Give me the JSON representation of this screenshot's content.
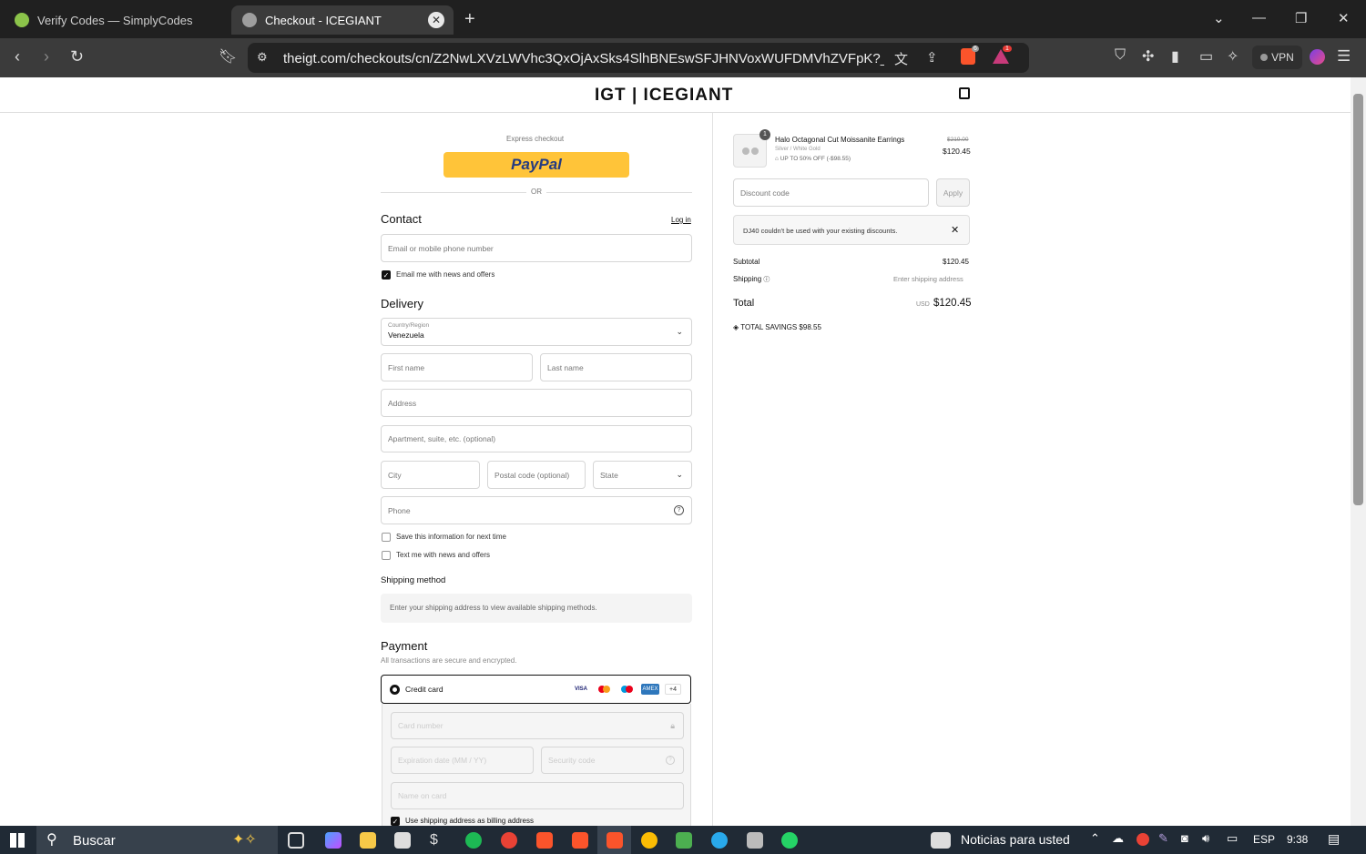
{
  "browser": {
    "tabs": [
      {
        "title": "Verify Codes — SimplyCodes"
      },
      {
        "title": "Checkout - ICEGIANT"
      }
    ],
    "url": "theigt.com/checkouts/cn/Z2NwLXVzLWVhc3QxOjAxSks4SlhBNEswSFJHNVoxWUFDMVhZVFpK?_ga=...",
    "vpn_label": "VPN",
    "brave_badge": "6",
    "alert_badge": "1"
  },
  "header": {
    "logo": "IGT | ICEGIANT"
  },
  "checkout": {
    "express_label": "Express checkout",
    "paypal_label": "PayPal",
    "or_label": "OR",
    "contact_title": "Contact",
    "login_link": "Log in",
    "email_placeholder": "Email or mobile phone number",
    "email_news": "Email me with news and offers",
    "delivery_title": "Delivery",
    "country_label": "Country/Region",
    "country_value": "Venezuela",
    "first_name": "First name",
    "last_name": "Last name",
    "address": "Address",
    "apartment": "Apartment, suite, etc. (optional)",
    "city": "City",
    "postal": "Postal code (optional)",
    "state": "State",
    "phone": "Phone",
    "save_info": "Save this information for next time",
    "text_news": "Text me with news and offers",
    "shipping_method_title": "Shipping method",
    "shipping_notice": "Enter your shipping address to view available shipping methods.",
    "payment_title": "Payment",
    "payment_sub": "All transactions are secure and encrypted.",
    "credit_card": "Credit card",
    "card_more": "+4",
    "card_number": "Card number",
    "expiration": "Expiration date (MM / YY)",
    "security": "Security code",
    "name_on_card": "Name on card",
    "billing_same": "Use shipping address as billing address"
  },
  "summary": {
    "quantity": "1",
    "product_name": "Halo Octagonal Cut Moissanite Earrings",
    "variant": "Silver / White Gold",
    "discount_line": "UP TO 50% OFF (-$98.55)",
    "original_price": "$219.00",
    "price": "$120.45",
    "discount_placeholder": "Discount code",
    "apply_label": "Apply",
    "error_message": "DJ40 couldn't be used with your existing discounts.",
    "subtotal_label": "Subtotal",
    "subtotal_value": "$120.45",
    "shipping_label": "Shipping",
    "shipping_value": "Enter shipping address",
    "total_label": "Total",
    "currency": "USD",
    "total_value": "$120.45",
    "savings_label": "TOTAL SAVINGS",
    "savings_value": "$98.55"
  },
  "taskbar": {
    "search_label": "Buscar",
    "news_label": "Noticias para usted",
    "language": "ESP",
    "time": "9:38"
  }
}
